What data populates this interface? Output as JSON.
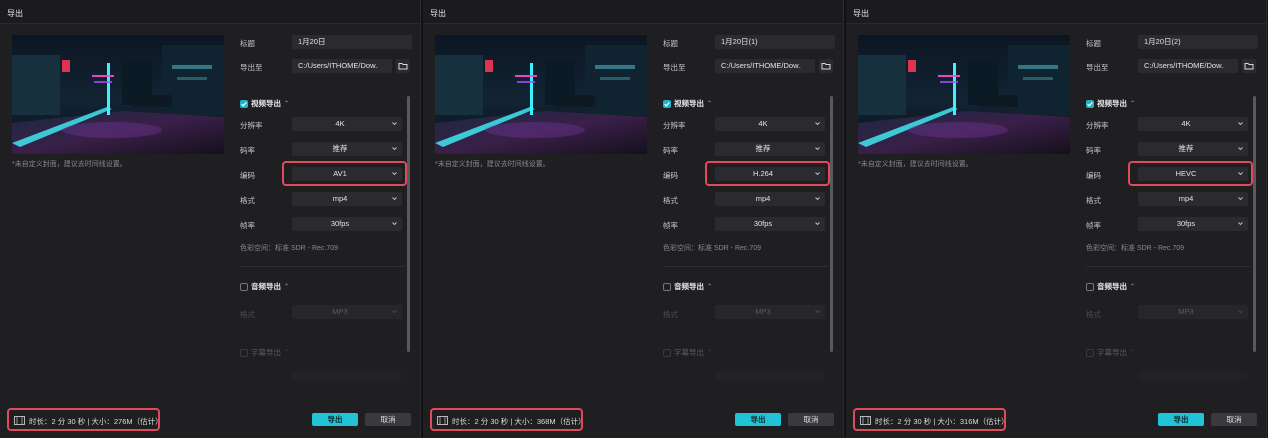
{
  "panels": [
    {
      "window_title": "导出",
      "cover_note": "*未自定义封面，建议去时间线设置。",
      "title_label": "标题",
      "title_value": "1月20日",
      "export_to_label": "导出至",
      "export_path": "C:/Users/ITHOME/Dow...",
      "video_section": "视频导出",
      "video_enabled": true,
      "resolution_label": "分辨率",
      "resolution": "4K",
      "bitrate_label": "码率",
      "bitrate": "推荐",
      "codec_label": "编码",
      "codec": "AV1",
      "format_label": "格式",
      "format": "mp4",
      "framerate_label": "帧率",
      "framerate": "30fps",
      "color_space": "色彩空间：标准 SDR - Rec.709",
      "audio_section": "音频导出",
      "audio_enabled": false,
      "audio_format_label": "格式",
      "audio_format": "MP3",
      "subtitle_section": "字幕导出",
      "footer_info": "时长：2 分 30 秒 | 大小：276M（估计）",
      "export_button": "导出",
      "cancel_button": "取消"
    },
    {
      "window_title": "导出",
      "cover_note": "*未自定义封面，建议去时间线设置。",
      "title_label": "标题",
      "title_value": "1月20日(1)",
      "export_to_label": "导出至",
      "export_path": "C:/Users/ITHOME/Dow...",
      "video_section": "视频导出",
      "video_enabled": true,
      "resolution_label": "分辨率",
      "resolution": "4K",
      "bitrate_label": "码率",
      "bitrate": "推荐",
      "codec_label": "编码",
      "codec": "H.264",
      "format_label": "格式",
      "format": "mp4",
      "framerate_label": "帧率",
      "framerate": "30fps",
      "color_space": "色彩空间：标准 SDR - Rec.709",
      "audio_section": "音频导出",
      "audio_enabled": false,
      "audio_format_label": "格式",
      "audio_format": "MP3",
      "subtitle_section": "字幕导出",
      "footer_info": "时长：2 分 30 秒 | 大小：368M（估计）",
      "export_button": "导出",
      "cancel_button": "取消"
    },
    {
      "window_title": "导出",
      "cover_note": "*未自定义封面，建议去时间线设置。",
      "title_label": "标题",
      "title_value": "1月20日(2)",
      "export_to_label": "导出至",
      "export_path": "C:/Users/ITHOME/Dow...",
      "video_section": "视频导出",
      "video_enabled": true,
      "resolution_label": "分辨率",
      "resolution": "4K",
      "bitrate_label": "码率",
      "bitrate": "推荐",
      "codec_label": "编码",
      "codec": "HEVC",
      "format_label": "格式",
      "format": "mp4",
      "framerate_label": "帧率",
      "framerate": "30fps",
      "color_space": "色彩空间：标准 SDR - Rec.709",
      "audio_section": "音频导出",
      "audio_enabled": false,
      "audio_format_label": "格式",
      "audio_format": "MP3",
      "subtitle_section": "字幕导出",
      "footer_info": "时长：2 分 30 秒 | 大小：316M（估计）",
      "export_button": "导出",
      "cancel_button": "取消"
    }
  ],
  "colors": {
    "accent": "#21c3d6",
    "highlight": "#e2495b",
    "panel_bg": "#1f1f22",
    "field_bg": "#2b2b2f"
  },
  "icons": {
    "folder": "folder-icon",
    "chevron": "chevron-down-icon",
    "film": "film-icon",
    "check": "check-icon"
  }
}
